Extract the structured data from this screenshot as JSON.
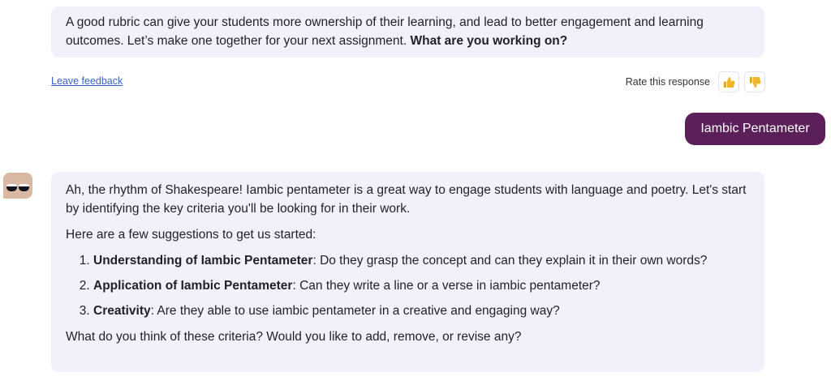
{
  "intro_message": {
    "text": "A good rubric can give your students more ownership of their learning, and lead to better engagement and learning outcomes. Let’s make one together for your next assignment. ",
    "bold": "What are you working on?"
  },
  "feedback": {
    "leave_feedback": "Leave feedback",
    "rate_label": "Rate this response",
    "thumbs_up_icon": "thumbs-up-icon",
    "thumbs_down_icon": "thumbs-down-icon"
  },
  "user_message": "Iambic Pentameter",
  "assistant_message": {
    "avatar_icon": "assistant-avatar-icon",
    "para1": "Ah, the rhythm of Shakespeare! Iambic pentameter is a great way to engage students with language and poetry. Let's start by identifying the key criteria you'll be looking for in their work.",
    "para2": "Here are a few suggestions to get us started:",
    "items": [
      {
        "title": "Understanding of Iambic Pentameter",
        "text": ": Do they grasp the concept and can they explain it in their own words?"
      },
      {
        "title": "Application of Iambic Pentameter",
        "text": ": Can they write a line or a verse in iambic pentameter?"
      },
      {
        "title": "Creativity",
        "text": ": Are they able to use iambic pentameter in a creative and engaging way?"
      }
    ],
    "para3": "What do you think of these criteria? Would you like to add, remove, or revise any?"
  },
  "colors": {
    "bubble_bg": "#f3f0fb",
    "user_bubble": "#5b1f59",
    "link": "#3a5fcf",
    "thumb_icon": "#e0a21c"
  }
}
